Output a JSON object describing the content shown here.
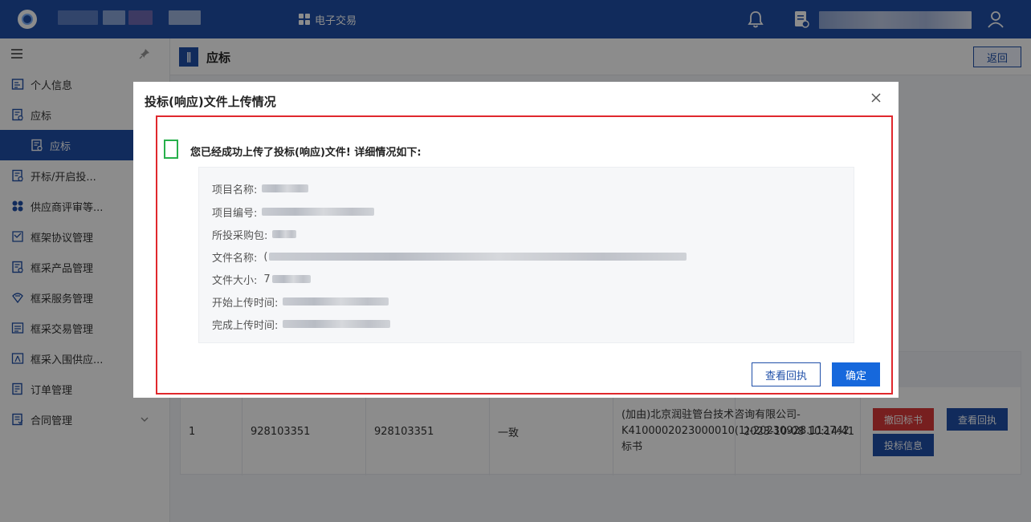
{
  "header": {
    "nav_trade_label": "电子交易"
  },
  "sidebar": {
    "items": [
      {
        "label": "个人信息"
      },
      {
        "label": "应标"
      },
      {
        "label": "应标"
      },
      {
        "label": "开标/开启投..."
      },
      {
        "label": "供应商评审等..."
      },
      {
        "label": "框架协议管理"
      },
      {
        "label": "框采产品管理"
      },
      {
        "label": "框采服务管理"
      },
      {
        "label": "框采交易管理"
      },
      {
        "label": "框采入围供应..."
      },
      {
        "label": "订单管理"
      },
      {
        "label": "合同管理"
      }
    ]
  },
  "main": {
    "title": "应标",
    "back_label": "返回",
    "table": {
      "row": {
        "index": "1",
        "col2": "928103351",
        "col3": "928103351",
        "status": "一致",
        "filename": "(加由)北京润驻管台技术咨询有限公司-K4100002023000010(1)-20230928.112742.标书",
        "time": "2023-10-08 10:14:41",
        "actions": {
          "withdraw": "撤回标书",
          "view_receipt": "查看回执",
          "bid_info": "投标信息"
        }
      }
    }
  },
  "modal": {
    "title": "投标(响应)文件上传情况",
    "success_msg": "您已经成功上传了投标(响应)文件! 详细情况如下:",
    "details": [
      {
        "label": "项目名称:",
        "value": ""
      },
      {
        "label": "项目编号:",
        "value": ""
      },
      {
        "label": "所投采购包:",
        "value": ""
      },
      {
        "label": "文件名称:",
        "value": "("
      },
      {
        "label": "文件大小:",
        "value": "7"
      },
      {
        "label": "开始上传时间:",
        "value": ""
      },
      {
        "label": "完成上传时间:",
        "value": ""
      }
    ],
    "view_receipt_label": "查看回执",
    "confirm_label": "确定"
  },
  "colors": {
    "brand": "#1f4fa8",
    "danger": "#d93a3a",
    "success": "#27b04b",
    "highlight": "#e0282d"
  }
}
